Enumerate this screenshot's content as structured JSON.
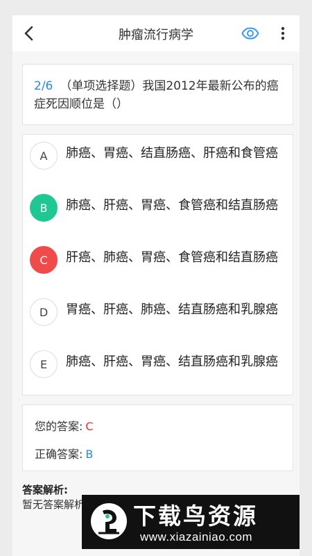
{
  "header": {
    "title": "肿瘤流行病学",
    "back_icon": "chevron-left-icon",
    "view_icon": "eye-icon",
    "more_icon": "more-vertical-icon"
  },
  "question": {
    "progress": "2/6",
    "text": "（单项选择题）我国2012年最新公布的癌症死因顺位是（）"
  },
  "options": [
    {
      "letter": "A",
      "text": "肺癌、胃癌、结直肠癌、肝癌和食管癌",
      "state": "normal"
    },
    {
      "letter": "B",
      "text": "肺癌、肝癌、胃癌、食管癌和结直肠癌",
      "state": "correct"
    },
    {
      "letter": "C",
      "text": "肝癌、肺癌、胃癌、食管癌和结直肠癌",
      "state": "wrong"
    },
    {
      "letter": "D",
      "text": "胃癌、肝癌、肺癌、结直肠癌和乳腺癌",
      "state": "normal"
    },
    {
      "letter": "E",
      "text": "肺癌、肝癌、胃癌、结直肠癌和乳腺癌",
      "state": "normal"
    }
  ],
  "answer": {
    "your_label": "您的答案:",
    "your_value": "C",
    "correct_label": "正确答案:",
    "correct_value": "B"
  },
  "analysis": {
    "title": "答案解析:",
    "text": "暂无答案解析"
  },
  "watermark": {
    "name": "下载鸟资源",
    "url": "www.xiazainiao.com"
  },
  "colors": {
    "accent_blue": "#2b8ad8",
    "correct_green": "#1fc892",
    "wrong_red": "#ef4b4b"
  }
}
